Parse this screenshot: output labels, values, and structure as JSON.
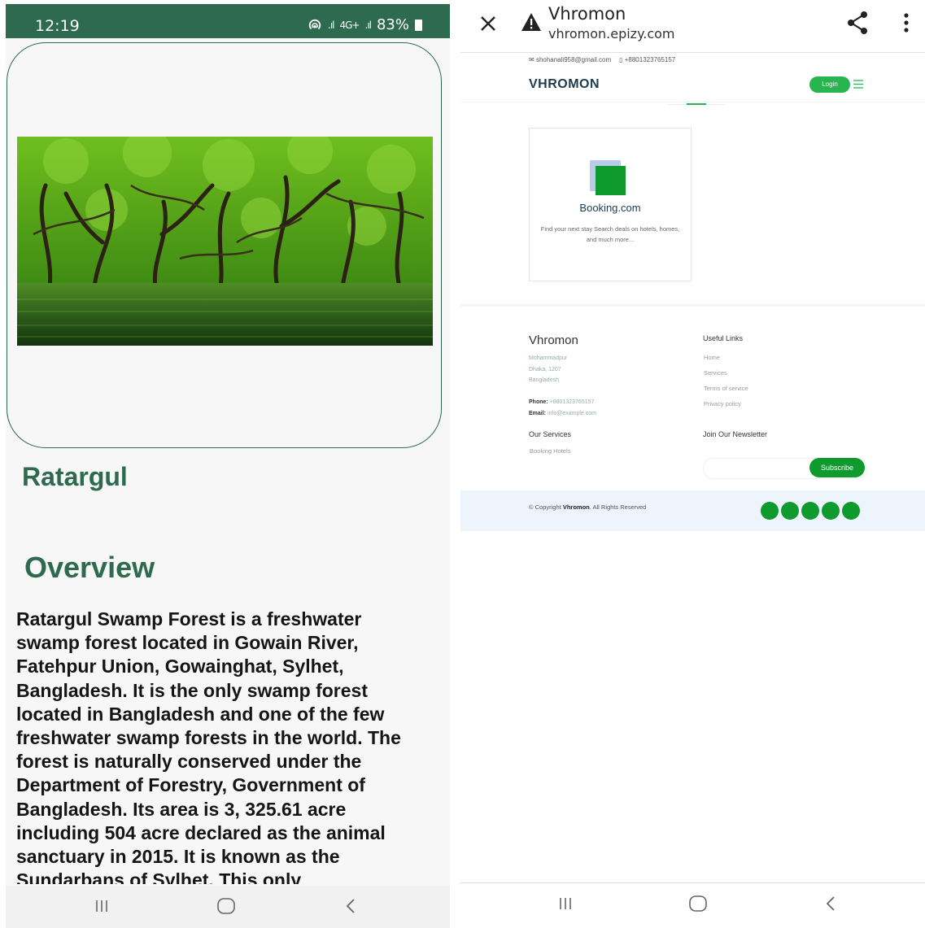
{
  "left_phone": {
    "status": {
      "time": "12:19",
      "network": "4G+",
      "battery": "83%"
    },
    "title": "Ratargul",
    "overview_heading": "Overview",
    "overview_text": "Ratargul Swamp Forest is a freshwater swamp forest located in Gowain River, Fatehpur Union, Gowainghat, Sylhet, Bangladesh. It is the only swamp forest located in Bangladesh and one of the few freshwater swamp forests in the world. The forest is naturally conserved under the Department of Forestry, Government of Bangladesh. Its area is 3, 325.61 acre including 504 acre declared as the animal sanctuary in 2015. It is known as the Sundarbans of Sylhet. This only"
  },
  "right_phone": {
    "browser": {
      "title": "Vhromon",
      "url": "vhromon.epizy.com"
    },
    "contact": {
      "email": "shohanali958@gmail.com",
      "phone": "+8801323765157"
    },
    "header": {
      "logo": "VHROMON",
      "login_label": "Login"
    },
    "service_card": {
      "title": "Booking.com",
      "description": "Find your next stay Search deals on hotels, homes, and much more..."
    },
    "footer": {
      "brand": "Vhromon",
      "address_line1": "Mohammadpur",
      "address_line2": "Dhaka, 1207",
      "address_line3": "Bangladesh",
      "phone_label": "Phone:",
      "phone_value": "+8801323765157",
      "email_label": "Email:",
      "email_value": "info@example.com",
      "useful_links_title": "Useful Links",
      "useful_links": [
        "Home",
        "Services",
        "Terms of service",
        "Privacy policy"
      ],
      "our_services_title": "Our Services",
      "our_services": [
        "Booking Hotels"
      ],
      "newsletter_title": "Join Our Newsletter",
      "subscribe_label": "Subscribe",
      "copyright_prefix": "© Copyright",
      "copyright_brand": "Vhromon",
      "copyright_suffix": ". All Rights Reserved"
    }
  },
  "colors": {
    "primary_green": "#2d6a4f",
    "accent_green": "#0e9a2c",
    "login_green": "#28b550"
  },
  "icons": [
    "close-icon",
    "warning-icon",
    "share-icon",
    "more-vert-icon",
    "menu-icon",
    "recents-icon",
    "home-icon",
    "back-icon",
    "hotspot-icon",
    "signal-icon",
    "battery-icon",
    "mail-icon",
    "phone-icon"
  ]
}
